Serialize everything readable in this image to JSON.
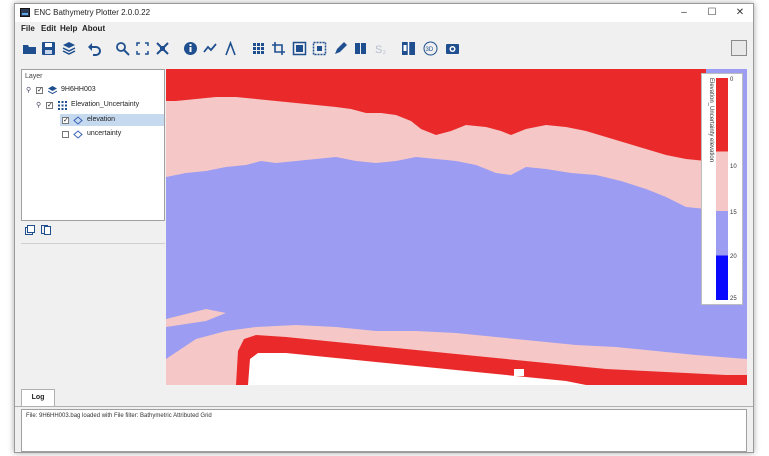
{
  "window": {
    "title": "ENC Bathymetry Plotter 2.0.0.22",
    "min": "–",
    "max": "☐",
    "close": "✕"
  },
  "menu": [
    "File",
    "Edit",
    "Help",
    "About"
  ],
  "toolbar": {
    "icons": [
      "open-folder-icon",
      "save-icon",
      "layers-icon",
      "undo-icon",
      "zoom-icon",
      "fit-extent-icon",
      "full-extent-icon",
      "info-icon",
      "line-profile-icon",
      "compass-icon",
      "grid-icon",
      "crop-icon",
      "frame-icon",
      "bbox-icon",
      "pencil-icon",
      "book-icon",
      "statistics-icon",
      "split-icon",
      "view-3d-icon",
      "camera-icon"
    ]
  },
  "layers": {
    "header": "Layer",
    "items": [
      {
        "label": "9H6HH003",
        "checked": true,
        "level": 0,
        "icon": "stack-layers-icon"
      },
      {
        "label": "Elevation_Uncertainty",
        "checked": true,
        "level": 1,
        "icon": "raster-grid-icon"
      },
      {
        "label": "elevation",
        "checked": true,
        "level": 2,
        "icon": "diamond-icon",
        "selected": true
      },
      {
        "label": "uncertainty",
        "checked": false,
        "level": 2,
        "icon": "diamond-icon"
      }
    ]
  },
  "map": {
    "colors": {
      "red": "#ea2a2a",
      "pink": "#f5c7c7",
      "blue": "#9b9cf2",
      "deep": "#0808ff",
      "white": "#ffffff"
    }
  },
  "legend": {
    "title": "Elevation_Uncertainty elevation",
    "ticks": [
      "0",
      "10",
      "15",
      "20",
      "25"
    ]
  },
  "log": {
    "tab": "Log",
    "text": "File: 9H6HH003.bag loaded with File filter: Bathymetric Attributed Grid"
  }
}
